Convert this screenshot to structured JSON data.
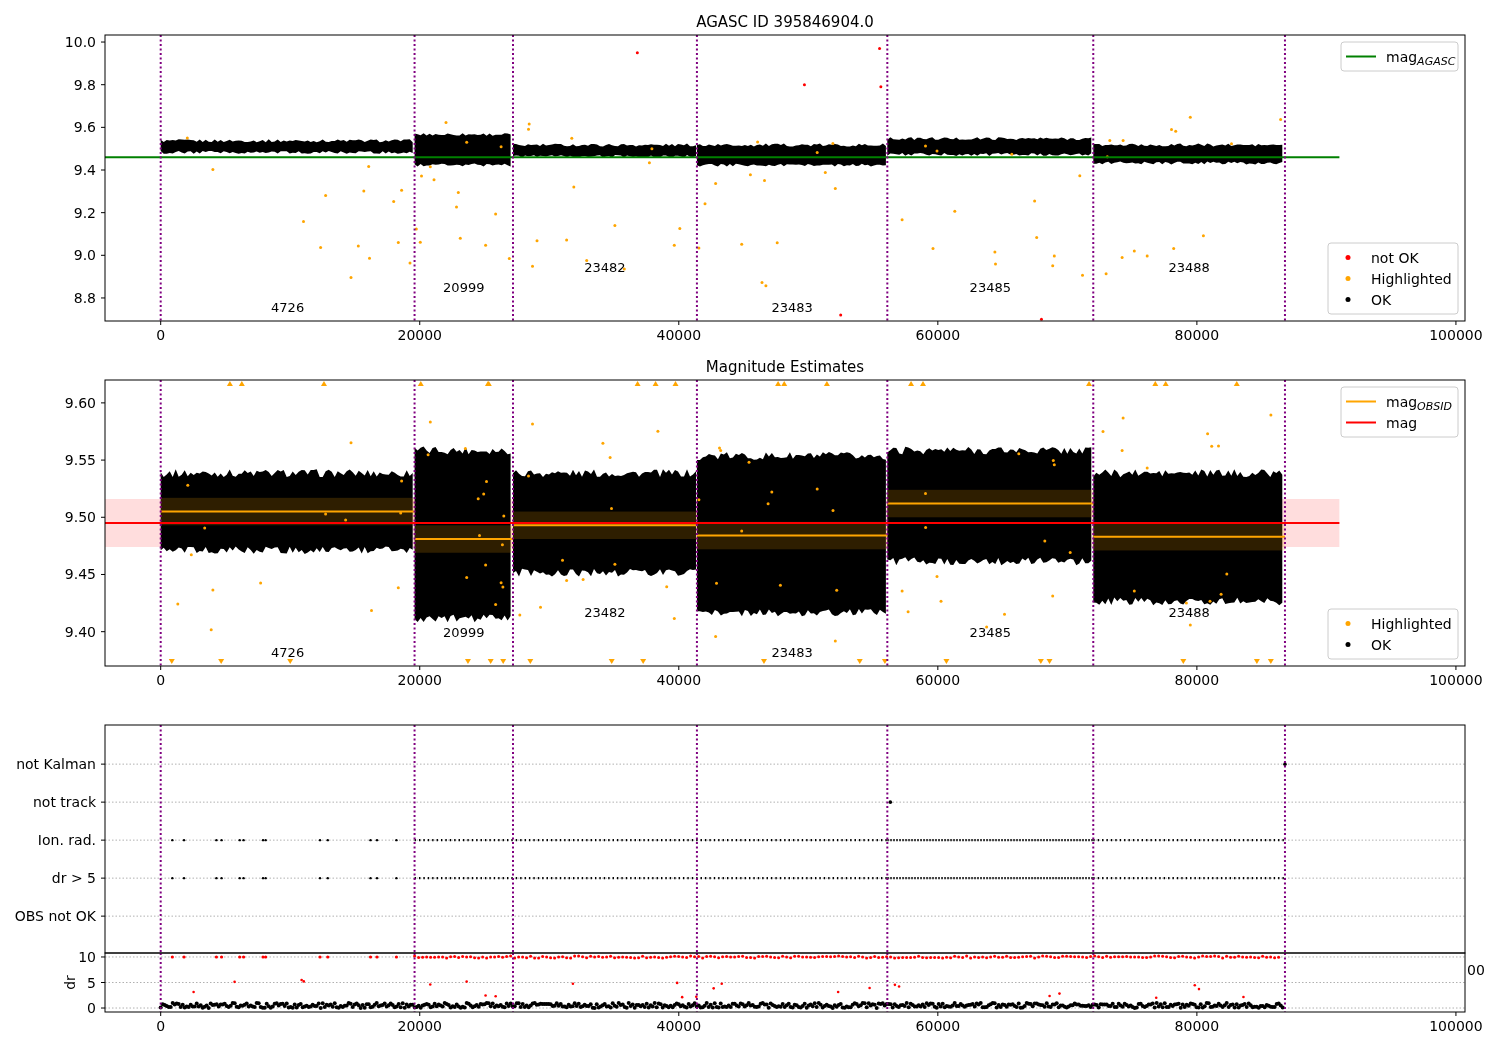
{
  "figure": {
    "panels": [
      {
        "kind": "agasc",
        "chart_data": {
          "type": "scatter",
          "title": "AGASC ID 395846904.0",
          "xlim": [
            -4300,
            100700
          ],
          "ylim": [
            8.692,
            10.033
          ],
          "xticks": [
            {
              "value": 0,
              "label": "0"
            },
            {
              "value": 20000,
              "label": "20000"
            },
            {
              "value": 40000,
              "label": "40000"
            },
            {
              "value": 60000,
              "label": "60000"
            },
            {
              "value": 80000,
              "label": "80000"
            },
            {
              "value": 100000,
              "label": "100000"
            }
          ],
          "yticks": [
            {
              "value": 8.8,
              "label": "8.8"
            },
            {
              "value": 9.0,
              "label": "9.0"
            },
            {
              "value": 9.2,
              "label": "9.2"
            },
            {
              "value": 9.4,
              "label": "9.4"
            },
            {
              "value": 9.6,
              "label": "9.6"
            },
            {
              "value": 9.8,
              "label": "9.8"
            },
            {
              "value": 10.0,
              "label": "10.0"
            }
          ],
          "series": [
            {
              "name": "mag$_{AGASC}$",
              "type": "line",
              "color": "#008000",
              "x": [
                -4300,
                91000
              ],
              "values": [
                9.46,
                9.46
              ]
            }
          ],
          "legend": "upper right",
          "ref_lines": [
            {
              "axis": "x",
              "value": 0,
              "color": "#800080"
            },
            {
              "axis": "x",
              "value": 19600,
              "color": "#800080"
            },
            {
              "axis": "x",
              "value": 27200,
              "color": "#800080"
            },
            {
              "axis": "x",
              "value": 41400,
              "color": "#800080"
            },
            {
              "axis": "x",
              "value": 56100,
              "color": "#800080"
            },
            {
              "axis": "x",
              "value": 72000,
              "color": "#800080"
            },
            {
              "axis": "x",
              "value": 86800,
              "color": "#800080"
            }
          ],
          "annotations": [
            "4726",
            "20999",
            "23482",
            "23483",
            "23485",
            "23488"
          ]
        },
        "legend_markers": [
          {
            "label": "not OK",
            "color": "#ff0000"
          },
          {
            "label": "Highlighted",
            "color": "#ffa500"
          },
          {
            "label": "OK",
            "color": "#000000"
          }
        ]
      },
      {
        "kind": "estimates",
        "chart_data": {
          "type": "scatter",
          "title": "Magnitude Estimates",
          "xlim": [
            -4300,
            100700
          ],
          "ylim": [
            9.37,
            9.62
          ],
          "xticks": [
            {
              "value": 0,
              "label": "0"
            },
            {
              "value": 20000,
              "label": "20000"
            },
            {
              "value": 40000,
              "label": "40000"
            },
            {
              "value": 60000,
              "label": "60000"
            },
            {
              "value": 80000,
              "label": "80000"
            },
            {
              "value": 100000,
              "label": "100000"
            }
          ],
          "yticks": [
            {
              "value": 9.4,
              "label": "9.40"
            },
            {
              "value": 9.45,
              "label": "9.45"
            },
            {
              "value": 9.5,
              "label": "9.50"
            },
            {
              "value": 9.55,
              "label": "9.55"
            },
            {
              "value": 9.6,
              "label": "9.60"
            }
          ],
          "series": [
            {
              "name": "mag$_{OBSID}$",
              "type": "line",
              "color": "#ffa500",
              "x": [
                0,
                19600,
                19600,
                27200,
                27200,
                41400,
                41400,
                56100,
                56100,
                72000,
                72000,
                86800
              ],
              "values": [
                9.505,
                9.505,
                9.481,
                9.481,
                9.493,
                9.493,
                9.484,
                9.484,
                9.512,
                9.512,
                9.483,
                9.483
              ]
            },
            {
              "name": "mag",
              "type": "line",
              "color": "#ff0000",
              "x": [
                -4300,
                91000
              ],
              "values": [
                9.495,
                9.495
              ]
            }
          ],
          "bands": [
            {
              "axis": "y",
              "from": 9.474,
              "to": 9.516,
              "color": "#ffdddd"
            }
          ],
          "legend": "upper right",
          "ref_lines": [
            {
              "axis": "x",
              "value": 0,
              "color": "#800080"
            },
            {
              "axis": "x",
              "value": 19600,
              "color": "#800080"
            },
            {
              "axis": "x",
              "value": 27200,
              "color": "#800080"
            },
            {
              "axis": "x",
              "value": 41400,
              "color": "#800080"
            },
            {
              "axis": "x",
              "value": 56100,
              "color": "#800080"
            },
            {
              "axis": "x",
              "value": 72000,
              "color": "#800080"
            },
            {
              "axis": "x",
              "value": 86800,
              "color": "#800080"
            }
          ],
          "annotations": [
            "4726",
            "20999",
            "23482",
            "23483",
            "23485",
            "23488"
          ]
        },
        "legend_markers": [
          {
            "label": "Highlighted",
            "color": "#ffa500"
          },
          {
            "label": "OK",
            "color": "#000000"
          }
        ]
      },
      {
        "kind": "flags",
        "row_labels": [
          "not Kalman",
          "not track",
          "Ion. rad.",
          "dr > 5",
          "OBS not OK"
        ],
        "cut_tick_label": "00"
      },
      {
        "kind": "dr",
        "chart_data": {
          "type": "scatter",
          "ylabel": "dr",
          "xlim": [
            -4300,
            100700
          ],
          "ylim": [
            -0.78,
            10.78
          ],
          "grid": true,
          "xticks": [
            {
              "value": 0,
              "label": "0"
            },
            {
              "value": 20000,
              "label": "20000"
            },
            {
              "value": 40000,
              "label": "40000"
            },
            {
              "value": 60000,
              "label": "60000"
            },
            {
              "value": 80000,
              "label": "80000"
            },
            {
              "value": 100000,
              "label": "100000"
            }
          ],
          "yticks": [
            {
              "value": 0,
              "label": "0"
            },
            {
              "value": 5,
              "label": "5"
            },
            {
              "value": 10,
              "label": "10"
            }
          ],
          "ref_lines": [
            {
              "axis": "x",
              "value": 0,
              "color": "#800080"
            },
            {
              "axis": "x",
              "value": 19600,
              "color": "#800080"
            },
            {
              "axis": "x",
              "value": 27200,
              "color": "#800080"
            },
            {
              "axis": "x",
              "value": 41400,
              "color": "#800080"
            },
            {
              "axis": "x",
              "value": 56100,
              "color": "#800080"
            },
            {
              "axis": "x",
              "value": 72000,
              "color": "#800080"
            },
            {
              "axis": "x",
              "value": 86800,
              "color": "#800080"
            }
          ]
        }
      }
    ]
  }
}
